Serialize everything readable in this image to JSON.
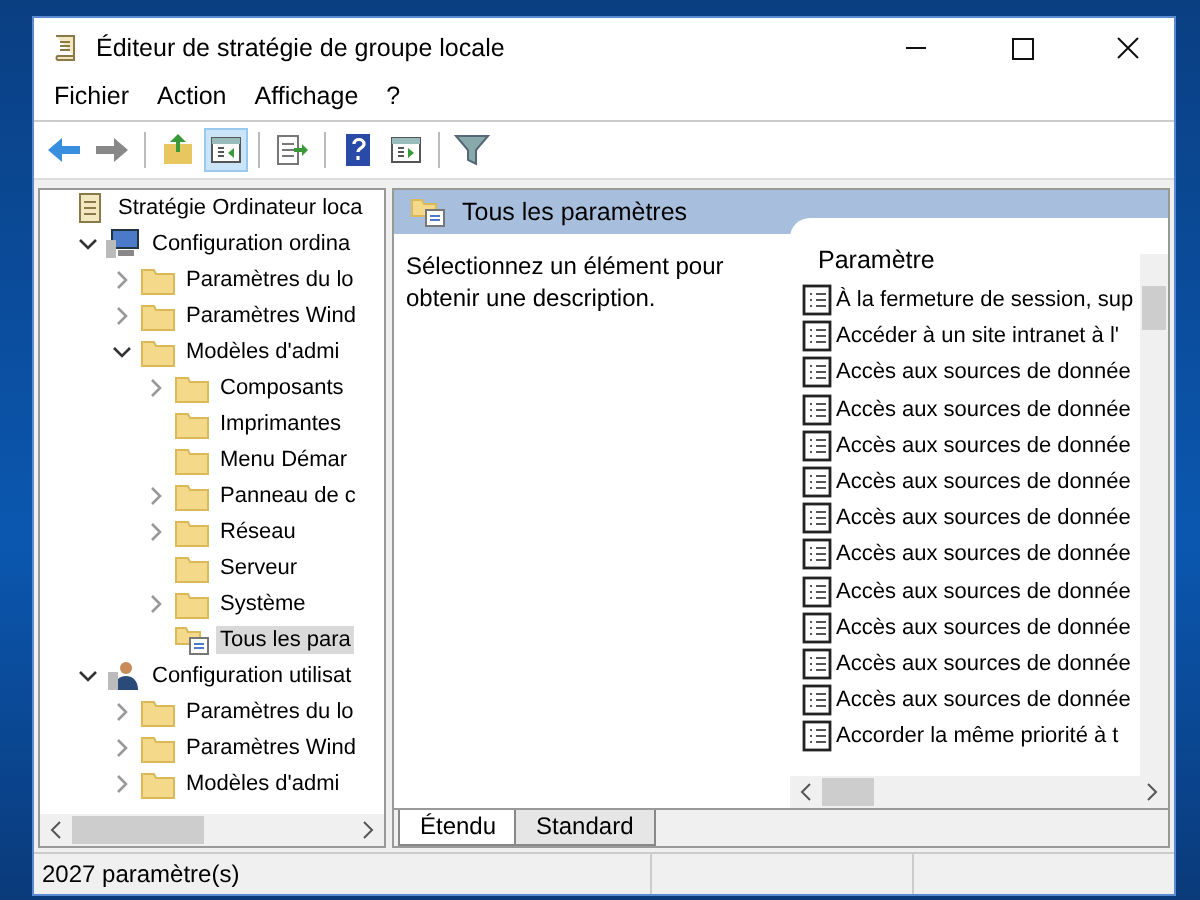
{
  "window": {
    "title": "Éditeur de stratégie de groupe locale"
  },
  "menu": [
    "Fichier",
    "Action",
    "Affichage",
    "?"
  ],
  "toolbar": [
    {
      "kind": "back"
    },
    {
      "kind": "forward"
    },
    {
      "kind": "sep"
    },
    {
      "kind": "up"
    },
    {
      "kind": "pane",
      "selected": true
    },
    {
      "kind": "sep"
    },
    {
      "kind": "export"
    },
    {
      "kind": "sep"
    },
    {
      "kind": "help"
    },
    {
      "kind": "pane2"
    },
    {
      "kind": "sep"
    },
    {
      "kind": "filter"
    }
  ],
  "tree": [
    {
      "label": "Stratégie Ordinateur loca",
      "kind": "policy",
      "expandable": false,
      "selected": false,
      "children": [
        {
          "label": "Configuration ordina",
          "kind": "computer",
          "expandable": true,
          "expanded": true,
          "selected": false,
          "children": [
            {
              "label": "Paramètres du lo",
              "kind": "folder",
              "expandable": true,
              "expanded": false,
              "selected": false
            },
            {
              "label": "Paramètres Wind",
              "kind": "folder",
              "expandable": true,
              "expanded": false,
              "selected": false
            },
            {
              "label": "Modèles d'admi",
              "kind": "folder",
              "expandable": true,
              "expanded": true,
              "selected": false,
              "children": [
                {
                  "label": "Composants",
                  "kind": "folder",
                  "expandable": true,
                  "expanded": false,
                  "selected": false
                },
                {
                  "label": "Imprimantes",
                  "kind": "folder",
                  "expandable": false,
                  "selected": false
                },
                {
                  "label": "Menu Démar",
                  "kind": "folder",
                  "expandable": false,
                  "selected": false
                },
                {
                  "label": "Panneau de c",
                  "kind": "folder",
                  "expandable": true,
                  "expanded": false,
                  "selected": false
                },
                {
                  "label": "Réseau",
                  "kind": "folder",
                  "expandable": true,
                  "expanded": false,
                  "selected": false
                },
                {
                  "label": "Serveur",
                  "kind": "folder",
                  "expandable": false,
                  "selected": false
                },
                {
                  "label": "Système",
                  "kind": "folder",
                  "expandable": true,
                  "expanded": false,
                  "selected": false
                },
                {
                  "label": "Tous les para",
                  "kind": "settings",
                  "expandable": false,
                  "selected": true
                }
              ]
            }
          ]
        },
        {
          "label": "Configuration utilisat",
          "kind": "user",
          "expandable": true,
          "expanded": true,
          "selected": false,
          "children": [
            {
              "label": "Paramètres du lo",
              "kind": "folder",
              "expandable": true,
              "expanded": false,
              "selected": false
            },
            {
              "label": "Paramètres Wind",
              "kind": "folder",
              "expandable": true,
              "expanded": false,
              "selected": false
            },
            {
              "label": "Modèles d'admi",
              "kind": "folder",
              "expandable": true,
              "expanded": false,
              "selected": false
            }
          ]
        }
      ]
    }
  ],
  "detail": {
    "title": "Tous les paramètres",
    "description": "Sélectionnez un élément pour obtenir une description.",
    "column": "Paramètre",
    "rows": [
      "À la fermeture de session, sup",
      "Accéder à un site intranet à l'",
      "Accès aux sources de donnée",
      "Accès aux sources de donnée",
      "Accès aux sources de donnée",
      "Accès aux sources de donnée",
      "Accès aux sources de donnée",
      "Accès aux sources de donnée",
      "Accès aux sources de donnée",
      "Accès aux sources de donnée",
      "Accès aux sources de donnée",
      "Accès aux sources de donnée",
      "Accorder la même priorité à t"
    ]
  },
  "tabs": [
    {
      "label": "Étendu",
      "selected": true
    },
    {
      "label": "Standard",
      "selected": false
    }
  ],
  "status_bar": "2027 paramètre(s)"
}
